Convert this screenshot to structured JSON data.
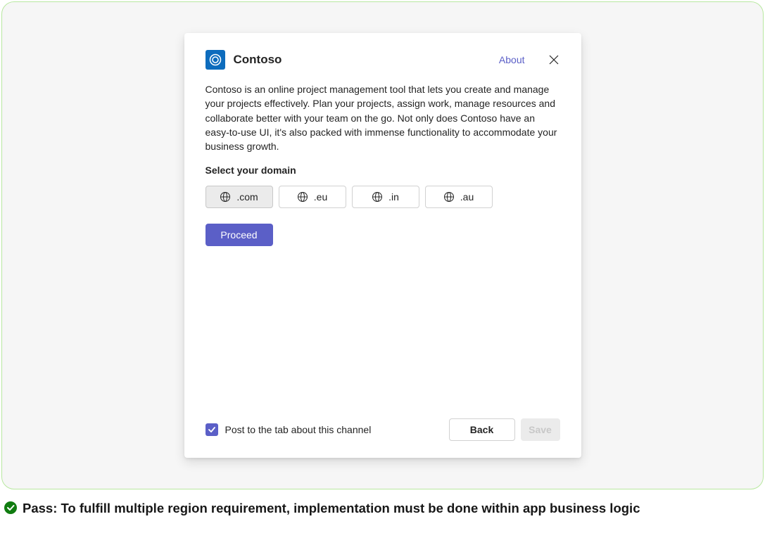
{
  "dialog": {
    "app_name": "Contoso",
    "about_link": "About",
    "description": "Contoso is an online project management tool that lets you create and manage your projects effectively. Plan your projects, assign work, manage resources and collaborate better with your team on the go. Not only does Contoso have an easy-to-use UI, it's also packed with immense functionality to accommodate your business growth.",
    "section_label": "Select your domain",
    "domains": [
      {
        "label": ".com",
        "selected": true
      },
      {
        "label": ".eu",
        "selected": false
      },
      {
        "label": ".in",
        "selected": false
      },
      {
        "label": ".au",
        "selected": false
      }
    ],
    "proceed_label": "Proceed",
    "checkbox_label": "Post to the tab about this channel",
    "checkbox_checked": true,
    "back_label": "Back",
    "save_label": "Save"
  },
  "pass_message": "Pass: To fulfill multiple region requirement, implementation must be done within app business logic",
  "colors": {
    "accent": "#5b5fc7",
    "frame_border": "#b8e8a0",
    "success": "#107c10"
  }
}
